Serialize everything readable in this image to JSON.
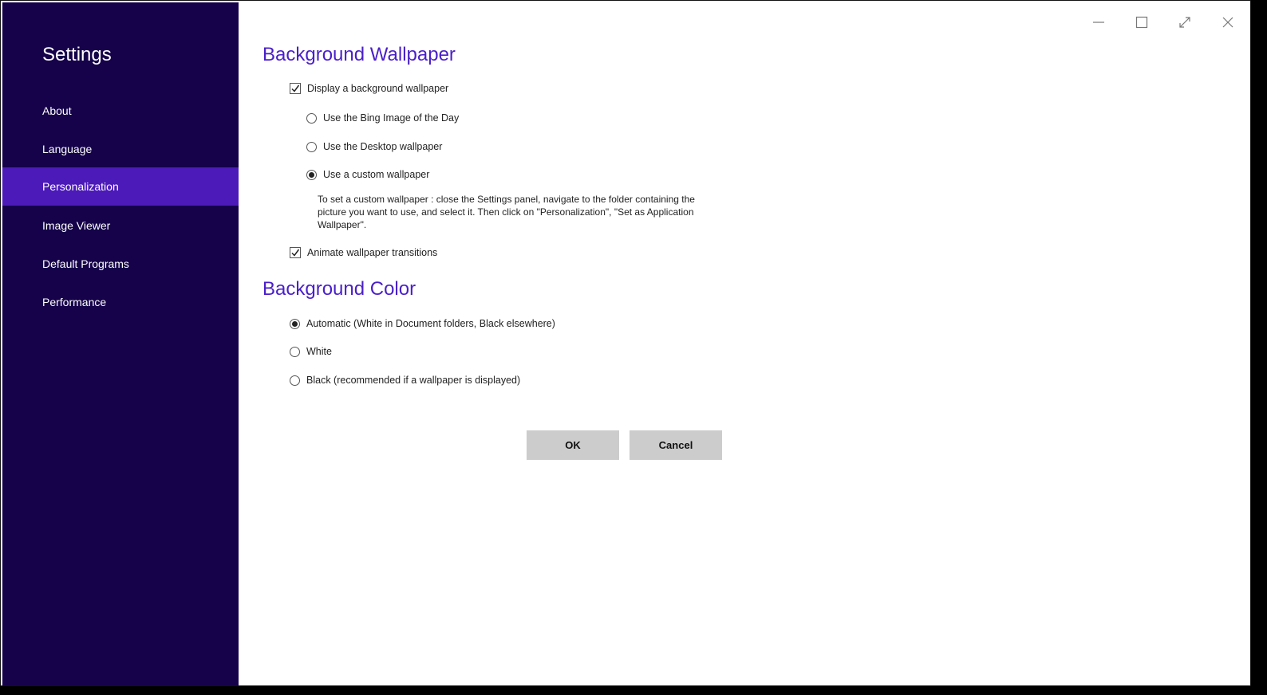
{
  "sidebar": {
    "title": "Settings",
    "items": [
      {
        "label": "About"
      },
      {
        "label": "Language"
      },
      {
        "label": "Personalization"
      },
      {
        "label": "Image Viewer"
      },
      {
        "label": "Default Programs"
      },
      {
        "label": "Performance"
      }
    ],
    "active_index": 2,
    "background": "#15024a",
    "active_color": "#4c1ab8"
  },
  "window_controls": [
    "minimize-icon",
    "maximize-icon",
    "fullscreen-icon",
    "close-icon"
  ],
  "wallpaper": {
    "title": "Background Wallpaper",
    "display_checkbox": {
      "label": "Display a background wallpaper",
      "checked": true
    },
    "options": [
      {
        "label": "Use the Bing Image of the Day",
        "selected": false
      },
      {
        "label": "Use the Desktop wallpaper",
        "selected": false
      },
      {
        "label": "Use a custom wallpaper",
        "selected": true
      }
    ],
    "info": "To set a custom wallpaper : close the Settings panel, navigate to the folder containing the picture you want to use, and select it. Then click on \"Personalization\", \"Set as Application Wallpaper\".",
    "animate_checkbox": {
      "label": "Animate wallpaper transitions",
      "checked": true
    }
  },
  "color": {
    "title": "Background Color",
    "options": [
      {
        "label": "Automatic (White in Document folders, Black elsewhere)",
        "selected": true
      },
      {
        "label": "White",
        "selected": false
      },
      {
        "label": "Black (recommended if a wallpaper is displayed)",
        "selected": false
      }
    ]
  },
  "buttons": {
    "ok": "OK",
    "cancel": "Cancel"
  },
  "accent_color": "#4a1fc9"
}
